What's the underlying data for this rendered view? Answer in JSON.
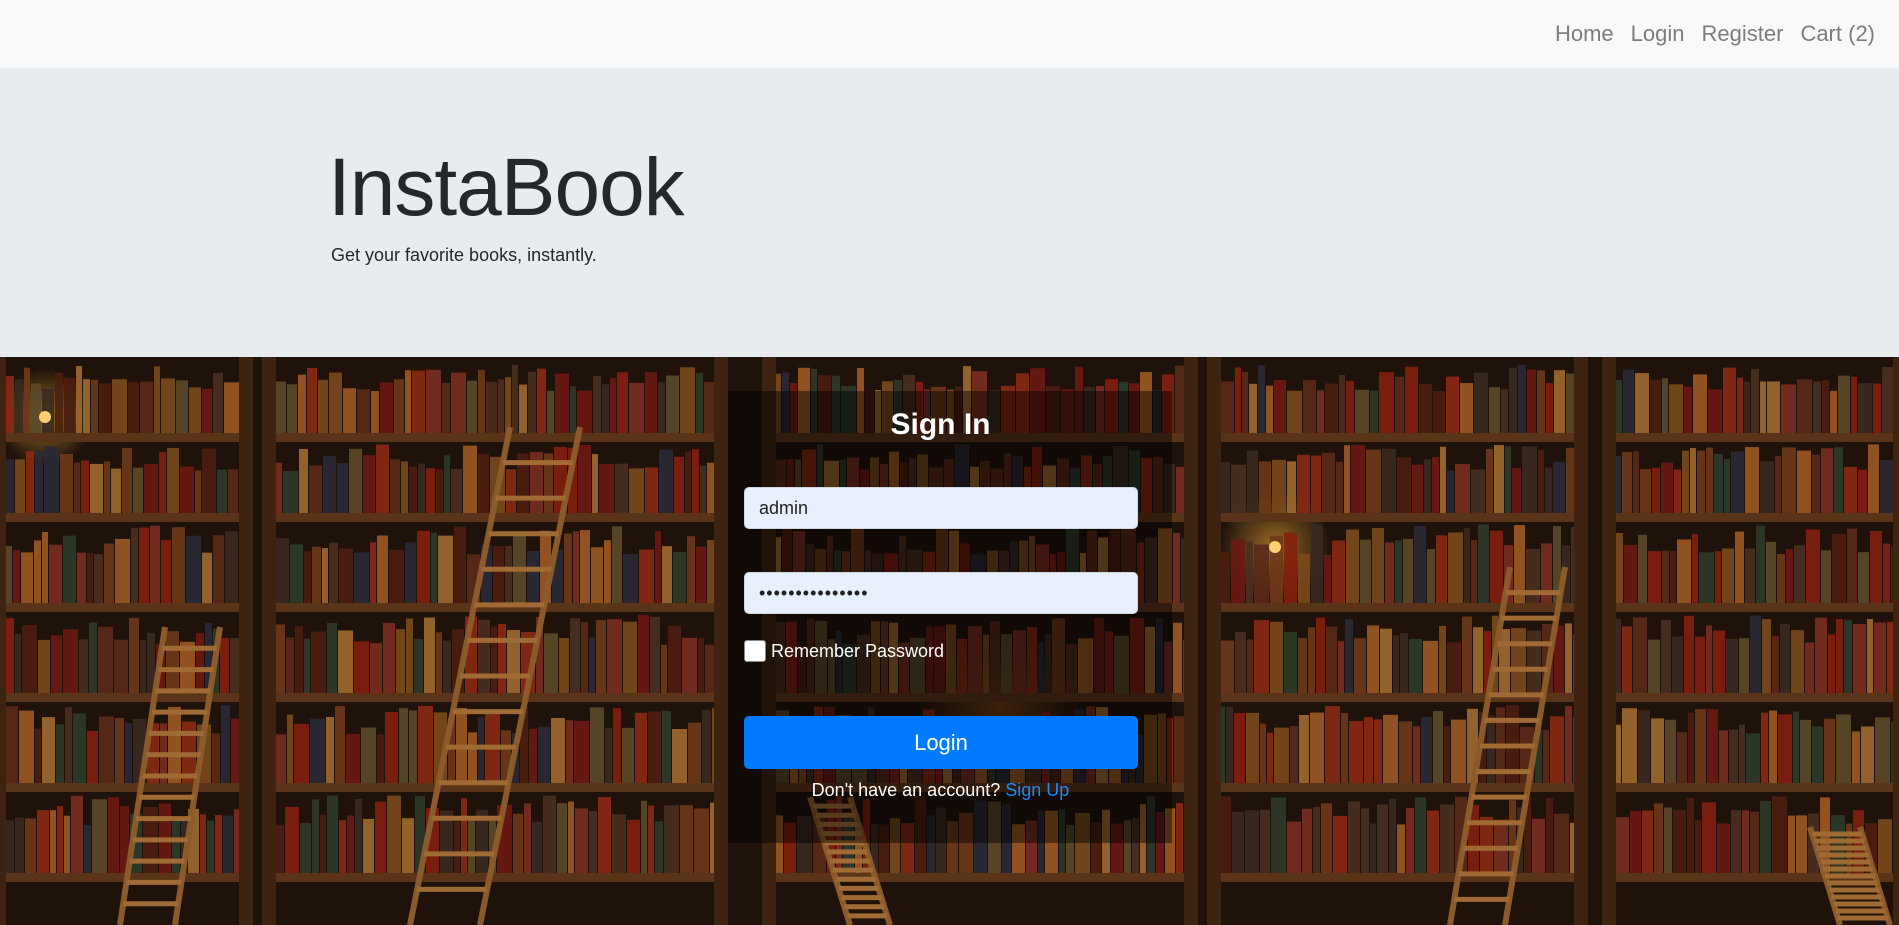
{
  "nav": {
    "items": [
      {
        "label": "Home"
      },
      {
        "label": "Login"
      },
      {
        "label": "Register"
      },
      {
        "label": "Cart (2)"
      }
    ]
  },
  "hero": {
    "title": "InstaBook",
    "tagline": "Get your favorite books, instantly."
  },
  "signin": {
    "title": "Sign In",
    "username_value": "admin",
    "password_value": "•••••••••••••••",
    "remember_label": "Remember Password",
    "login_label": "Login",
    "signup_prompt": "Don't have an account?",
    "signup_link": "Sign Up"
  },
  "colors": {
    "navbar_bg": "#f8f9fa",
    "jumbotron_bg": "#e9ecef",
    "primary": "#007bff",
    "input_bg": "#e8f0fe"
  }
}
